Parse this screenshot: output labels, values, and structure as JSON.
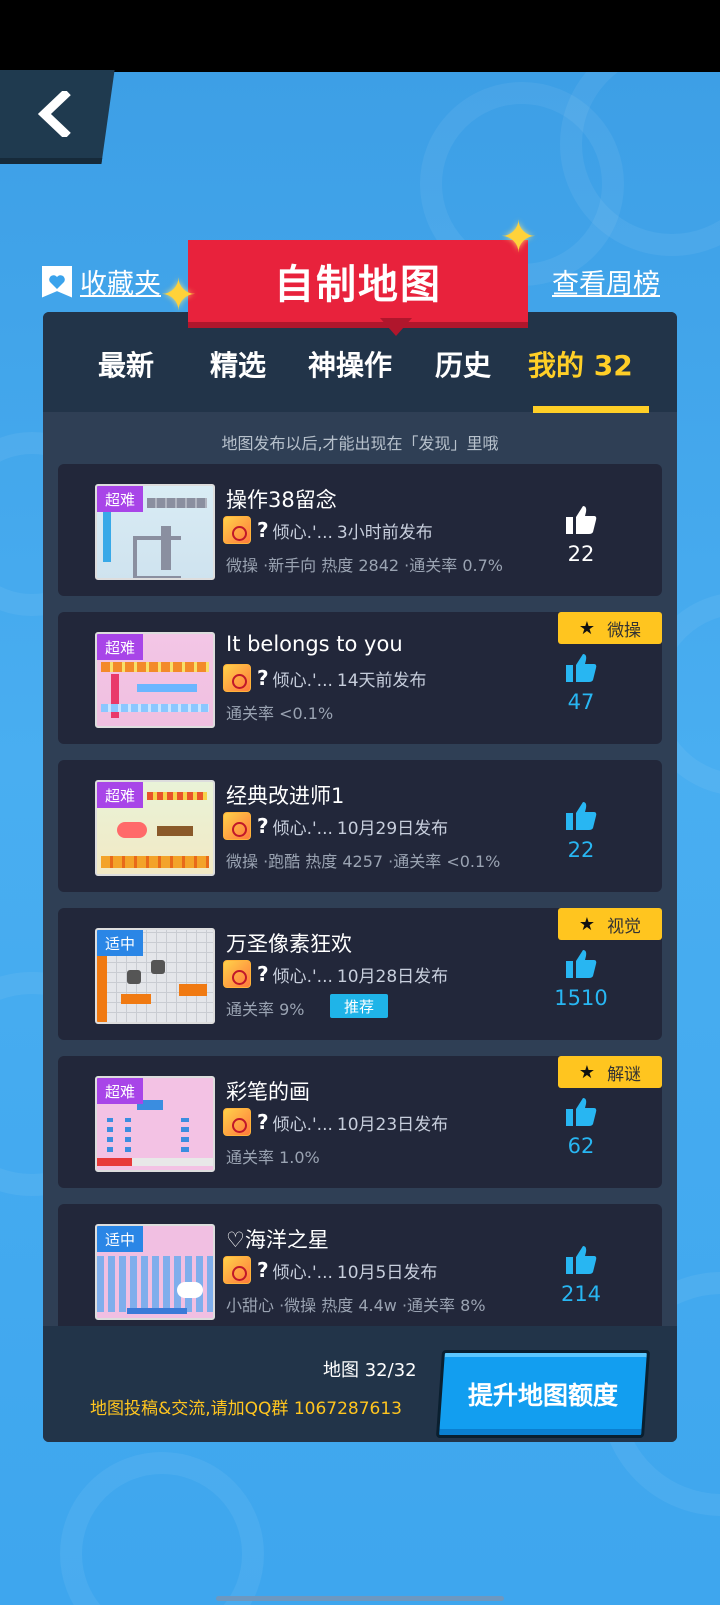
{
  "header": {
    "favorites_label": "收藏夹",
    "title": "自制地图",
    "weekly_rank_label": "查看周榜"
  },
  "tabs": [
    {
      "label": "最新",
      "active": false
    },
    {
      "label": "精选",
      "active": false
    },
    {
      "label": "神操作",
      "active": false
    },
    {
      "label": "历史",
      "active": false
    },
    {
      "label": "我的 32",
      "active": true
    }
  ],
  "notice": "地图发布以后,才能出现在「发现」里哦",
  "maps": [
    {
      "difficulty": "超难",
      "title": "操作38留念",
      "author": "倾心.'...",
      "time": "3小时前发布",
      "stats": "微操 ·新手向 热度 2842 ·通关率 0.7%",
      "likes": "22",
      "tag": "",
      "recommended": ""
    },
    {
      "difficulty": "超难",
      "title": "It belongs to you",
      "author": "倾心.'...",
      "time": "14天前发布",
      "stats": "通关率 <0.1%",
      "likes": "47",
      "tag": "微操",
      "recommended": ""
    },
    {
      "difficulty": "超难",
      "title": "经典改进师1",
      "author": "倾心.'...",
      "time": "10月29日发布",
      "stats": "微操 ·跑酷 热度 4257 ·通关率 <0.1%",
      "likes": "22",
      "tag": "",
      "recommended": ""
    },
    {
      "difficulty": "适中",
      "title": "万圣像素狂欢",
      "author": "倾心.'...",
      "time": "10月28日发布",
      "stats": "通关率 9%",
      "likes": "1510",
      "tag": "视觉",
      "recommended": "推荐"
    },
    {
      "difficulty": "超难",
      "title": "彩笔的画",
      "author": "倾心.'...",
      "time": "10月23日发布",
      "stats": "通关率 1.0%",
      "likes": "62",
      "tag": "解谜",
      "recommended": ""
    },
    {
      "difficulty": "适中",
      "title": "♡海洋之星",
      "author": "倾心.'...",
      "time": "10月5日发布",
      "stats": "小甜心 ·微操 热度 4.4w ·通关率 8%",
      "likes": "214",
      "tag": "",
      "recommended": ""
    }
  ],
  "footer": {
    "map_count": "地图 32/32",
    "qq_group": "地图投稿&交流,请加QQ群 1067287613",
    "upgrade_label": "提升地图额度"
  },
  "colors": {
    "accent": "#ffcf27",
    "like_blue": "#28b6f2",
    "hard_badge": "#a845e8",
    "medium_badge": "#2a86e6",
    "banner_red": "#e8223c"
  }
}
